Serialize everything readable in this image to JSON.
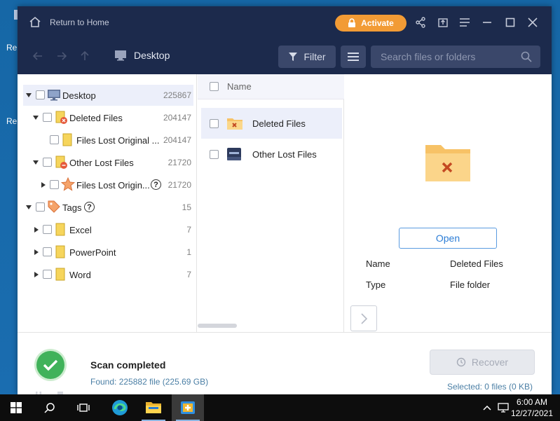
{
  "desktop": {
    "labels": [
      "Re",
      "Re"
    ]
  },
  "titlebar": {
    "home_label": "Return to Home",
    "activate_label": "Activate"
  },
  "toolbar": {
    "breadcrumb": "Desktop",
    "filter_label": "Filter",
    "search_placeholder": "Search files or folders"
  },
  "tree": {
    "items": [
      {
        "label": "Desktop",
        "count": "225867",
        "icon": "desktop-icon"
      },
      {
        "label": "Deleted Files",
        "count": "204147",
        "icon": "deleted-folder-icon"
      },
      {
        "label": "Files Lost Original ...",
        "count": "204147",
        "icon": "folder-icon"
      },
      {
        "label": "Other Lost Files",
        "count": "21720",
        "icon": "lost-folder-icon"
      },
      {
        "label": "Files Lost Origin...",
        "count": "21720",
        "icon": "star-icon",
        "help": "?"
      },
      {
        "label": "Tags",
        "count": "15",
        "icon": "tag-icon",
        "help": "?"
      },
      {
        "label": "Excel",
        "count": "7",
        "icon": "folder-icon"
      },
      {
        "label": "PowerPoint",
        "count": "1",
        "icon": "folder-icon"
      },
      {
        "label": "Word",
        "count": "7",
        "icon": "folder-icon"
      }
    ]
  },
  "list": {
    "header": "Name",
    "items": [
      {
        "label": "Deleted Files",
        "icon": "deleted-folder-icon"
      },
      {
        "label": "Other Lost Files",
        "icon": "drive-icon"
      }
    ]
  },
  "preview": {
    "open_label": "Open",
    "props": [
      {
        "key": "Name",
        "value": "Deleted Files"
      },
      {
        "key": "Type",
        "value": "File folder"
      }
    ]
  },
  "status": {
    "title": "Scan completed",
    "found": "Found: 225882 file (225.69 GB)",
    "recover_label": "Recover",
    "selected": "Selected: 0 files (0 KB)"
  },
  "taskbar": {
    "time": "6:00 AM",
    "date": "12/27/2021"
  },
  "colors": {
    "titlebar": "#1c2a4c",
    "accent_orange": "#f29b35",
    "success_green": "#40b25a",
    "link_blue": "#2c7dd6"
  }
}
